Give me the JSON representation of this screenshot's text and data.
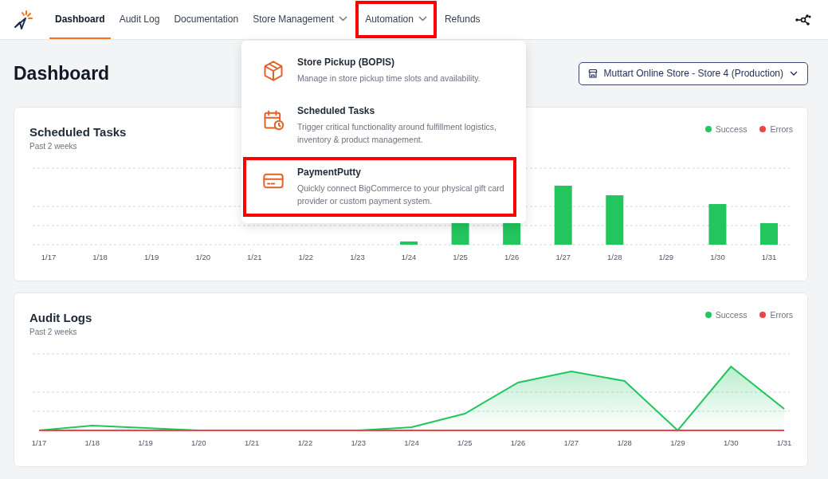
{
  "nav": {
    "items": [
      {
        "label": "Dashboard",
        "selected": true,
        "has_menu": false,
        "highlighted": false
      },
      {
        "label": "Audit Log",
        "selected": false,
        "has_menu": false,
        "highlighted": false
      },
      {
        "label": "Documentation",
        "selected": false,
        "has_menu": false,
        "highlighted": false
      },
      {
        "label": "Store Management",
        "selected": false,
        "has_menu": true,
        "highlighted": false
      },
      {
        "label": "Automation",
        "selected": false,
        "has_menu": true,
        "highlighted": true
      },
      {
        "label": "Refunds",
        "selected": false,
        "has_menu": false,
        "highlighted": false
      }
    ]
  },
  "page_title": "Dashboard",
  "store_selector": {
    "label": "Muttart Online Store - Store 4 (Production)"
  },
  "automation_menu": {
    "items": [
      {
        "kind": "box",
        "title": "Store Pickup (BOPIS)",
        "description": "Manage in store pickup time slots and availability.",
        "highlighted": false
      },
      {
        "kind": "calendar",
        "title": "Scheduled Tasks",
        "description": "Trigger critical functionality around fulfillment logistics, inventory & product management.",
        "highlighted": false
      },
      {
        "kind": "card",
        "title": "PaymentPutty",
        "description": "Quickly connect BigCommerce to your physical gift card provider or custom payment system.",
        "highlighted": true
      }
    ]
  },
  "cards": [
    {
      "kind": "bar",
      "title": "Scheduled Tasks",
      "subtitle": "Past 2 weeks",
      "legend": [
        {
          "label": "Success",
          "color": "#22c55e"
        },
        {
          "label": "Errors",
          "color": "#ef4444"
        }
      ],
      "x_labels": [
        "1/17",
        "1/18",
        "1/19",
        "1/20",
        "1/21",
        "1/22",
        "1/23",
        "1/24",
        "1/25",
        "1/26",
        "1/27",
        "1/28",
        "1/29",
        "1/30",
        "1/31"
      ]
    },
    {
      "kind": "area",
      "title": "Audit Logs",
      "subtitle": "Past 2 weeks",
      "legend": [
        {
          "label": "Success",
          "color": "#22c55e"
        },
        {
          "label": "Errors",
          "color": "#ef4444"
        }
      ],
      "x_labels": [
        "1/17",
        "1/18",
        "1/19",
        "1/20",
        "1/21",
        "1/22",
        "1/23",
        "1/24",
        "1/25",
        "1/26",
        "1/27",
        "1/28",
        "1/29",
        "1/30",
        "1/31"
      ]
    }
  ]
}
